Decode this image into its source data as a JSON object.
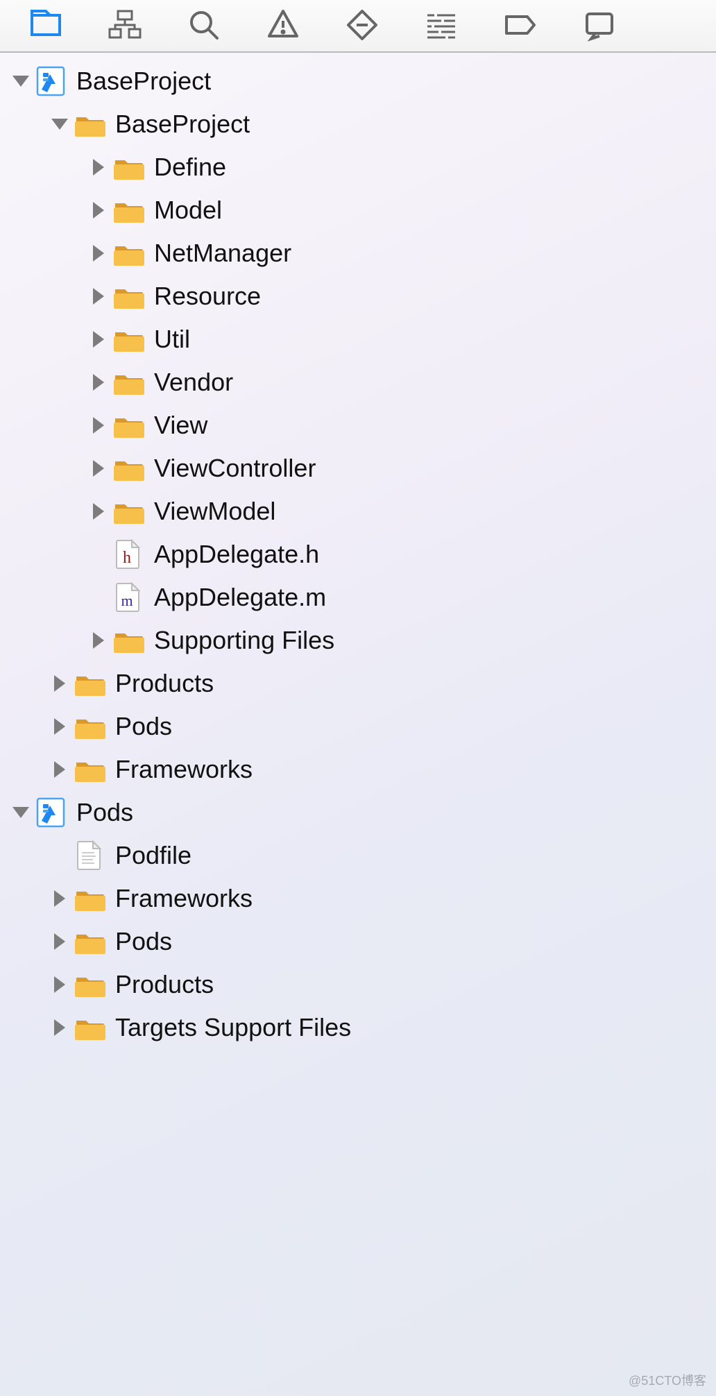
{
  "toolbar": {
    "icons": [
      "project-navigator",
      "source-control",
      "search",
      "issues",
      "tests",
      "debug",
      "breakpoints",
      "reports"
    ]
  },
  "colors": {
    "folder": "#F6C04B",
    "folder_tab": "#D99A2B",
    "accent_blue": "#1E88F0",
    "arrow_gray": "#8A8A8A"
  },
  "tree": [
    {
      "label": "BaseProject",
      "depth": 0,
      "icon": "xcodeproj",
      "expanded": true,
      "hasChildren": true
    },
    {
      "label": "BaseProject",
      "depth": 1,
      "icon": "folder",
      "expanded": true,
      "hasChildren": true
    },
    {
      "label": "Define",
      "depth": 2,
      "icon": "folder",
      "expanded": false,
      "hasChildren": true
    },
    {
      "label": "Model",
      "depth": 2,
      "icon": "folder",
      "expanded": false,
      "hasChildren": true
    },
    {
      "label": "NetManager",
      "depth": 2,
      "icon": "folder",
      "expanded": false,
      "hasChildren": true
    },
    {
      "label": "Resource",
      "depth": 2,
      "icon": "folder",
      "expanded": false,
      "hasChildren": true
    },
    {
      "label": "Util",
      "depth": 2,
      "icon": "folder",
      "expanded": false,
      "hasChildren": true
    },
    {
      "label": "Vendor",
      "depth": 2,
      "icon": "folder",
      "expanded": false,
      "hasChildren": true
    },
    {
      "label": "View",
      "depth": 2,
      "icon": "folder",
      "expanded": false,
      "hasChildren": true
    },
    {
      "label": "ViewController",
      "depth": 2,
      "icon": "folder",
      "expanded": false,
      "hasChildren": true
    },
    {
      "label": "ViewModel",
      "depth": 2,
      "icon": "folder",
      "expanded": false,
      "hasChildren": true
    },
    {
      "label": "AppDelegate.h",
      "depth": 2,
      "icon": "h-file",
      "expanded": false,
      "hasChildren": false
    },
    {
      "label": "AppDelegate.m",
      "depth": 2,
      "icon": "m-file",
      "expanded": false,
      "hasChildren": false
    },
    {
      "label": "Supporting Files",
      "depth": 2,
      "icon": "folder",
      "expanded": false,
      "hasChildren": true
    },
    {
      "label": "Products",
      "depth": 1,
      "icon": "folder",
      "expanded": false,
      "hasChildren": true
    },
    {
      "label": "Pods",
      "depth": 1,
      "icon": "folder",
      "expanded": false,
      "hasChildren": true
    },
    {
      "label": "Frameworks",
      "depth": 1,
      "icon": "folder",
      "expanded": false,
      "hasChildren": true
    },
    {
      "label": "Pods",
      "depth": 0,
      "icon": "xcodeproj",
      "expanded": true,
      "hasChildren": true
    },
    {
      "label": "Podfile",
      "depth": 1,
      "icon": "text-file",
      "expanded": false,
      "hasChildren": false
    },
    {
      "label": "Frameworks",
      "depth": 1,
      "icon": "folder",
      "expanded": false,
      "hasChildren": true
    },
    {
      "label": "Pods",
      "depth": 1,
      "icon": "folder",
      "expanded": false,
      "hasChildren": true
    },
    {
      "label": "Products",
      "depth": 1,
      "icon": "folder",
      "expanded": false,
      "hasChildren": true
    },
    {
      "label": "Targets Support Files",
      "depth": 1,
      "icon": "folder",
      "expanded": false,
      "hasChildren": true
    }
  ],
  "watermark": "@51CTO博客"
}
